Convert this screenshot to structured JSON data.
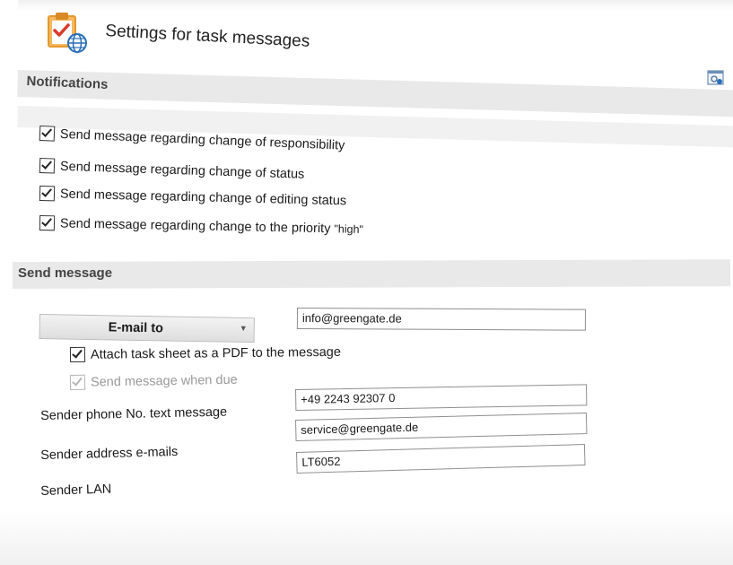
{
  "header": {
    "title": "Settings for task messages",
    "icon": "task-settings-icon"
  },
  "notifications": {
    "section_title": "Notifications",
    "options": [
      {
        "label": "Send message regarding change of responsibility",
        "checked": true
      },
      {
        "label": "Send message regarding change of status",
        "checked": true
      },
      {
        "label": "Send message regarding change of editing status",
        "checked": true
      },
      {
        "label_main": "Send message regarding change to the priority ",
        "label_small": "\"high\"",
        "checked": true
      }
    ]
  },
  "send_message": {
    "section_title": "Send message",
    "recipient_type": "E-mail to",
    "recipient_value": "info@greengate.de",
    "attach_pdf": {
      "label": "Attach task sheet as a PDF to the message",
      "checked": true
    },
    "send_when_due": {
      "label": "Send message when due",
      "checked": true,
      "enabled": false
    },
    "fields": {
      "phone": {
        "label": "Sender phone No. text message",
        "value": "+49 2243 92307 0"
      },
      "address": {
        "label": "Sender address e-mails",
        "value": "service@greengate.de"
      },
      "lan": {
        "label": "Sender LAN",
        "value": "LT6052"
      }
    }
  },
  "colors": {
    "section_bar": "#e9e9e9",
    "icon_orange": "#f0a13a",
    "icon_blue": "#2a6fb8",
    "check_red": "#d93b2b"
  }
}
